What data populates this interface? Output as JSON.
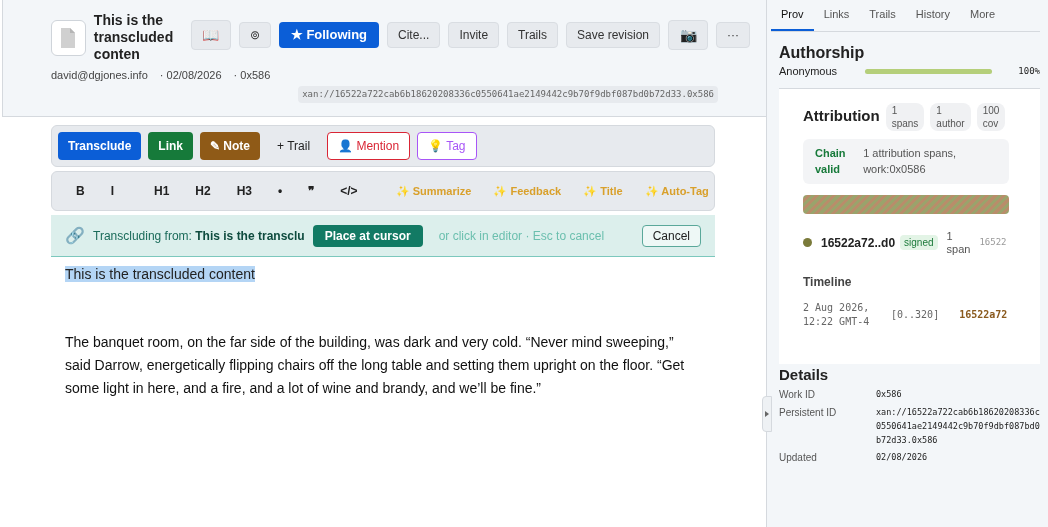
{
  "document": {
    "title": "This is the transcluded conten",
    "author": "david@dgjones.info",
    "date": "· 02/08/2026",
    "work_id": "· 0x586",
    "persistent_id": "xan://16522a722cab6b18620208336c0550641ae2149442c9b70f9dbf087bd0b72d33.0x586"
  },
  "header_buttons": [
    {
      "kind": "icon",
      "label": "📖"
    },
    {
      "kind": "plain",
      "label": "⊚"
    },
    {
      "kind": "primary",
      "label": "★ Following"
    },
    {
      "kind": "plain",
      "label": "Cite..."
    },
    {
      "kind": "plain",
      "label": "Invite"
    },
    {
      "kind": "plain",
      "label": "Trails"
    },
    {
      "kind": "plain",
      "label": "Save revision"
    },
    {
      "kind": "icon",
      "label": "📷"
    },
    {
      "kind": "plain",
      "label": "···"
    }
  ],
  "action_buttons": [
    {
      "kind": "solid",
      "label": "Transclude",
      "color": "#0b5ed7"
    },
    {
      "kind": "solid",
      "label": "Link",
      "color": "#167a3a"
    },
    {
      "kind": "solid",
      "label": "✎ Note",
      "color": "#8f5a17"
    },
    {
      "kind": "text",
      "label": "+ Trail",
      "color": "#222222"
    },
    {
      "kind": "outline",
      "label": "👤 Mention",
      "color": "#d92535"
    },
    {
      "kind": "outline",
      "label": "💡 Tag",
      "color": "#a855f7"
    }
  ],
  "format_buttons": [
    {
      "kind": "format",
      "label": "B"
    },
    {
      "kind": "format",
      "label": "I"
    },
    {
      "kind": "divider"
    },
    {
      "kind": "format",
      "label": "H1"
    },
    {
      "kind": "format",
      "label": "H2"
    },
    {
      "kind": "format",
      "label": "H3"
    },
    {
      "kind": "format",
      "label": "•"
    },
    {
      "kind": "format",
      "label": "❞"
    },
    {
      "kind": "format",
      "label": "</>"
    },
    {
      "kind": "divider"
    },
    {
      "kind": "ai",
      "label": "✨ Summarize"
    },
    {
      "kind": "ai",
      "label": "✨ Feedback"
    },
    {
      "kind": "ai",
      "label": "✨ Title"
    },
    {
      "kind": "ai",
      "label": "✨ Auto-Tag"
    }
  ],
  "transclusion_bar": {
    "icon": "🔗",
    "prefix": "Transcluding from:",
    "source": "This is the transclu",
    "place_button": "Place at cursor",
    "hint": "or click in editor · Esc to cancel",
    "cancel_button": "Cancel"
  },
  "editor": {
    "selected_text": "This is the transcluded content",
    "paragraph": "The banquet room, on the far side of the building, was dark and very cold. “Never mind sweeping,” said Darrow, energetically flipping chairs off the long table and setting them upright on the floor. “Get some light in here, and a fire, and a lot of wine and brandy, and we’ll be fine.”"
  },
  "side_tabs": [
    {
      "label": "Prov",
      "selected": true
    },
    {
      "label": "Links",
      "selected": false
    },
    {
      "label": "Trails",
      "selected": false
    },
    {
      "label": "History",
      "selected": false
    },
    {
      "label": "More",
      "selected": false
    }
  ],
  "authorship": {
    "title": "Authorship",
    "author": "Anonymous",
    "level": 1,
    "percent": "100%"
  },
  "attribution": {
    "title": "Attribution",
    "pills": [
      [
        "1",
        "spans"
      ],
      [
        "1",
        "author"
      ],
      [
        "100",
        "cov"
      ]
    ],
    "chain": {
      "status": "Chain valid",
      "detail": "1 attribution spans, work:0x0586"
    },
    "author_row": {
      "hash": "16522a72..d0",
      "badge": "signed",
      "spans": [
        "1",
        "span"
      ],
      "trailing": "16522"
    },
    "timeline_title": "Timeline",
    "timeline": [
      {
        "time": "2 Aug 2026, 12:22 GMT-4",
        "range": "[0..320]",
        "hash": "16522a72"
      }
    ]
  },
  "details": {
    "title": "Details",
    "rows": [
      {
        "label": "Work ID",
        "value": "0x586"
      },
      {
        "label": "Persistent ID",
        "value": "xan://16522a722cab6b18620208336c0550641ae2149442c9b70f9dbf087bd0b72d33.0x586"
      },
      {
        "label": "Updated",
        "value": "02/08/2026"
      }
    ]
  }
}
